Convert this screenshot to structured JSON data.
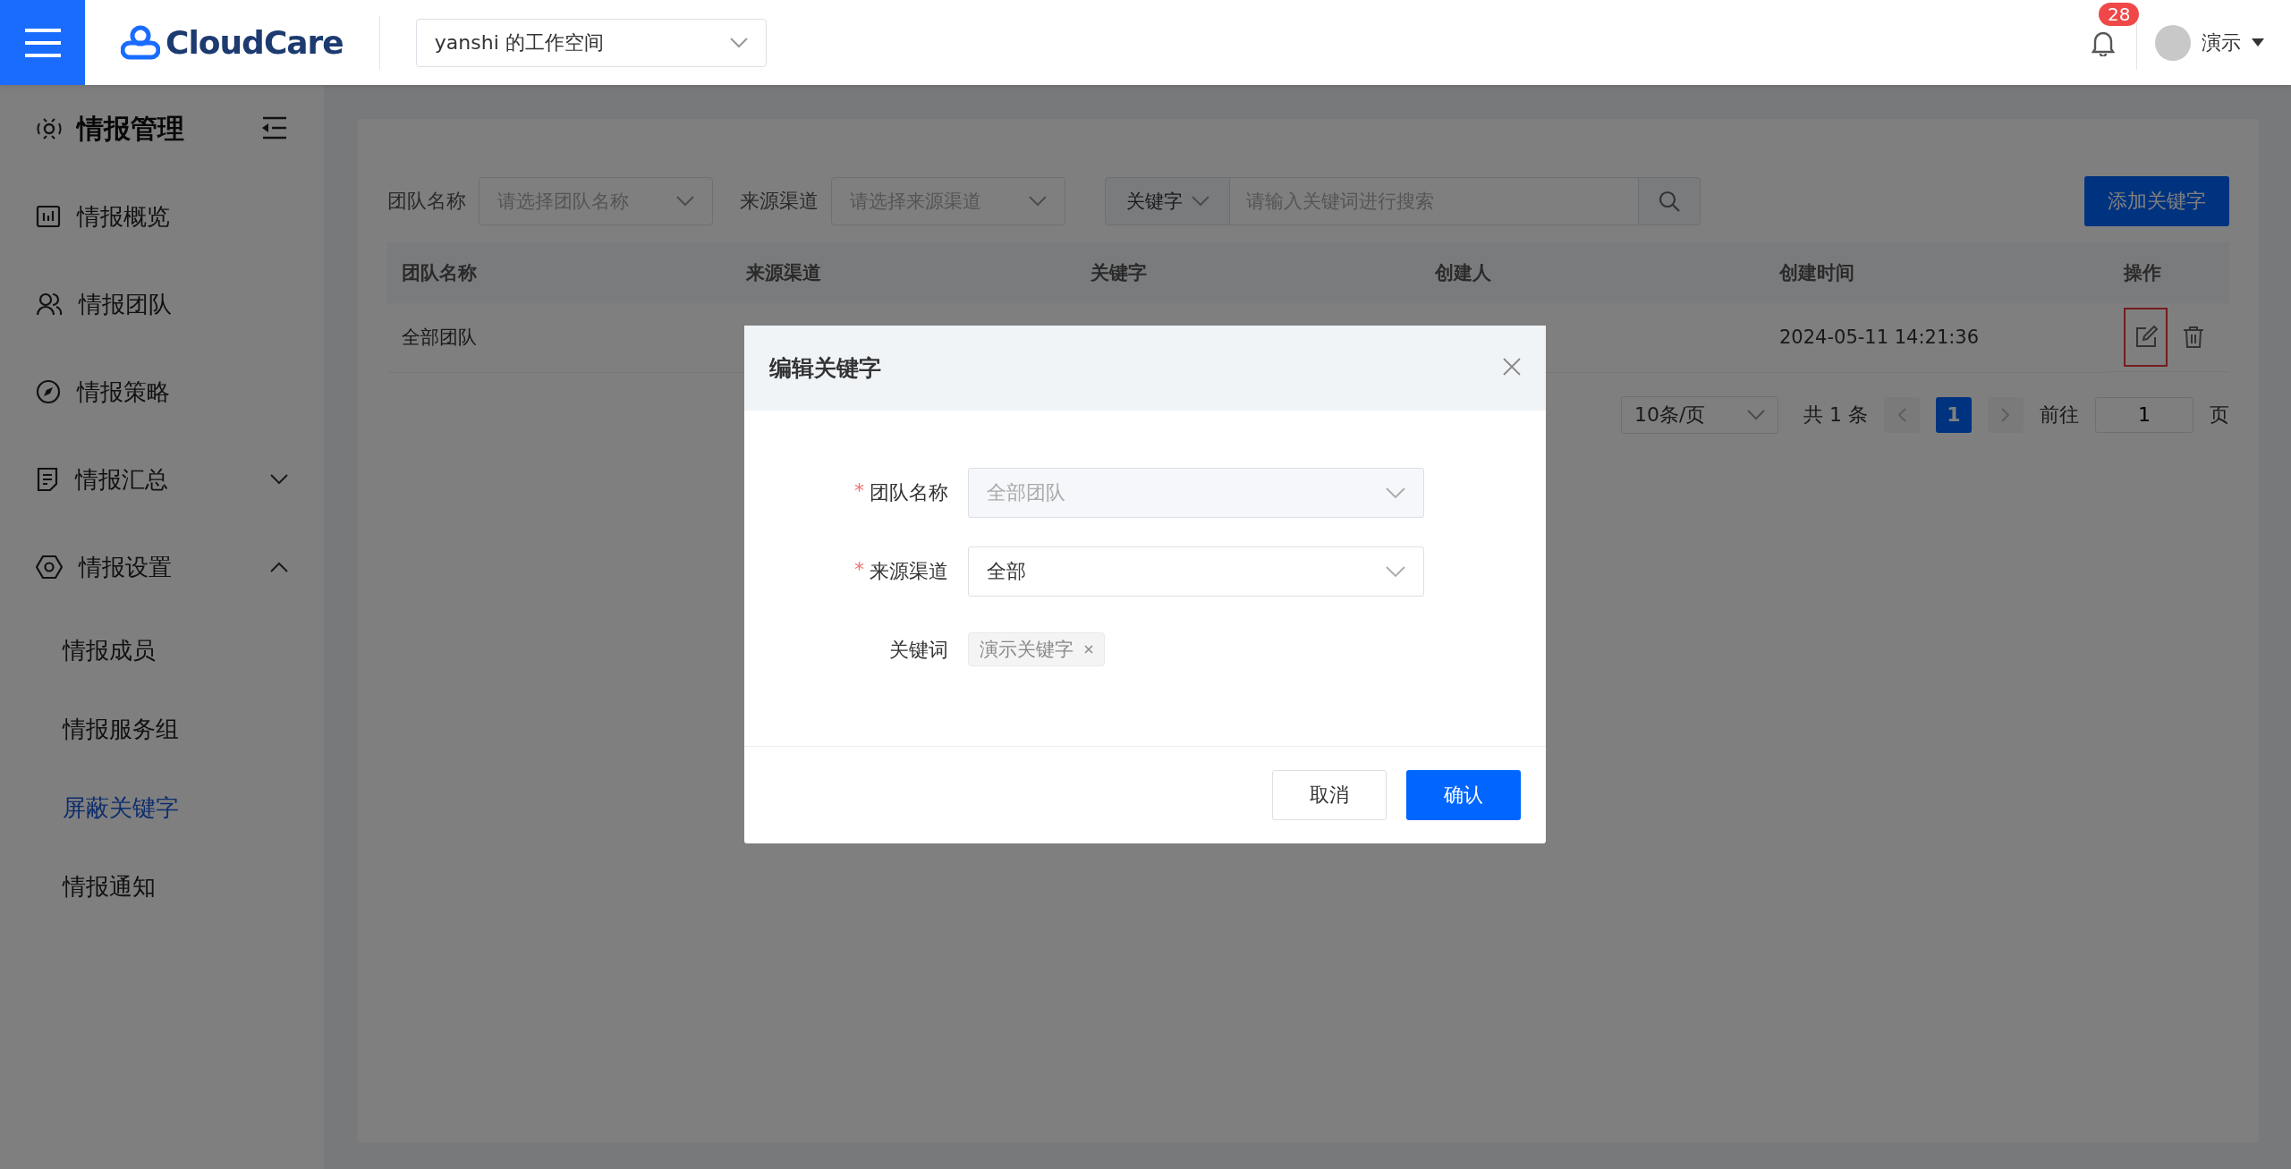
{
  "topbar": {
    "logo": "CloudCare",
    "workspace": "yanshi 的工作空间",
    "notification_count": "28",
    "user": "演示"
  },
  "sidebar": {
    "title": "情报管理",
    "items": [
      {
        "label": "情报概览",
        "kind": "link"
      },
      {
        "label": "情报团队",
        "kind": "link"
      },
      {
        "label": "情报策略",
        "kind": "link"
      },
      {
        "label": "情报汇总",
        "kind": "group",
        "expanded": false
      },
      {
        "label": "情报设置",
        "kind": "group",
        "expanded": true,
        "children": [
          {
            "label": "情报成员",
            "selected": false
          },
          {
            "label": "情报服务组",
            "selected": false
          },
          {
            "label": "屏蔽关键字",
            "selected": true
          },
          {
            "label": "情报通知",
            "selected": false
          }
        ]
      }
    ]
  },
  "filters": [
    {
      "label": "团队名称",
      "placeholder": "请选择团队名称"
    },
    {
      "label": "来源渠道",
      "placeholder": "请选择来源渠道"
    }
  ],
  "search": {
    "type": "关键字",
    "placeholder": "请输入关键词进行搜索"
  },
  "add_button": "添加关键字",
  "table": {
    "columns": [
      "团队名称",
      "来源渠道",
      "关键字",
      "创建人",
      "创建时间",
      "操作"
    ],
    "rows": [
      {
        "team": "全部团队",
        "created": "2024-05-11 14:21:36",
        "edit_highlighted": true
      }
    ]
  },
  "pagination": {
    "page_size": "10条/页",
    "total": "共 1 条",
    "pages": [
      {
        "label": "1",
        "selected": true
      }
    ],
    "goto_label": "前往",
    "goto_value": "1",
    "page_suffix": "页"
  },
  "dialog": {
    "title": "编辑关键字",
    "fields": [
      {
        "label": "团队名称",
        "required_mark": "*",
        "kind": "select",
        "value": "全部团队",
        "disabled": true
      },
      {
        "label": "来源渠道",
        "required_mark": "*",
        "kind": "select",
        "value": "全部",
        "disabled": false
      },
      {
        "label": "关键词",
        "kind": "tags",
        "tags": [
          "演示关键字"
        ]
      }
    ],
    "cancel": "取消",
    "confirm": "确认"
  }
}
